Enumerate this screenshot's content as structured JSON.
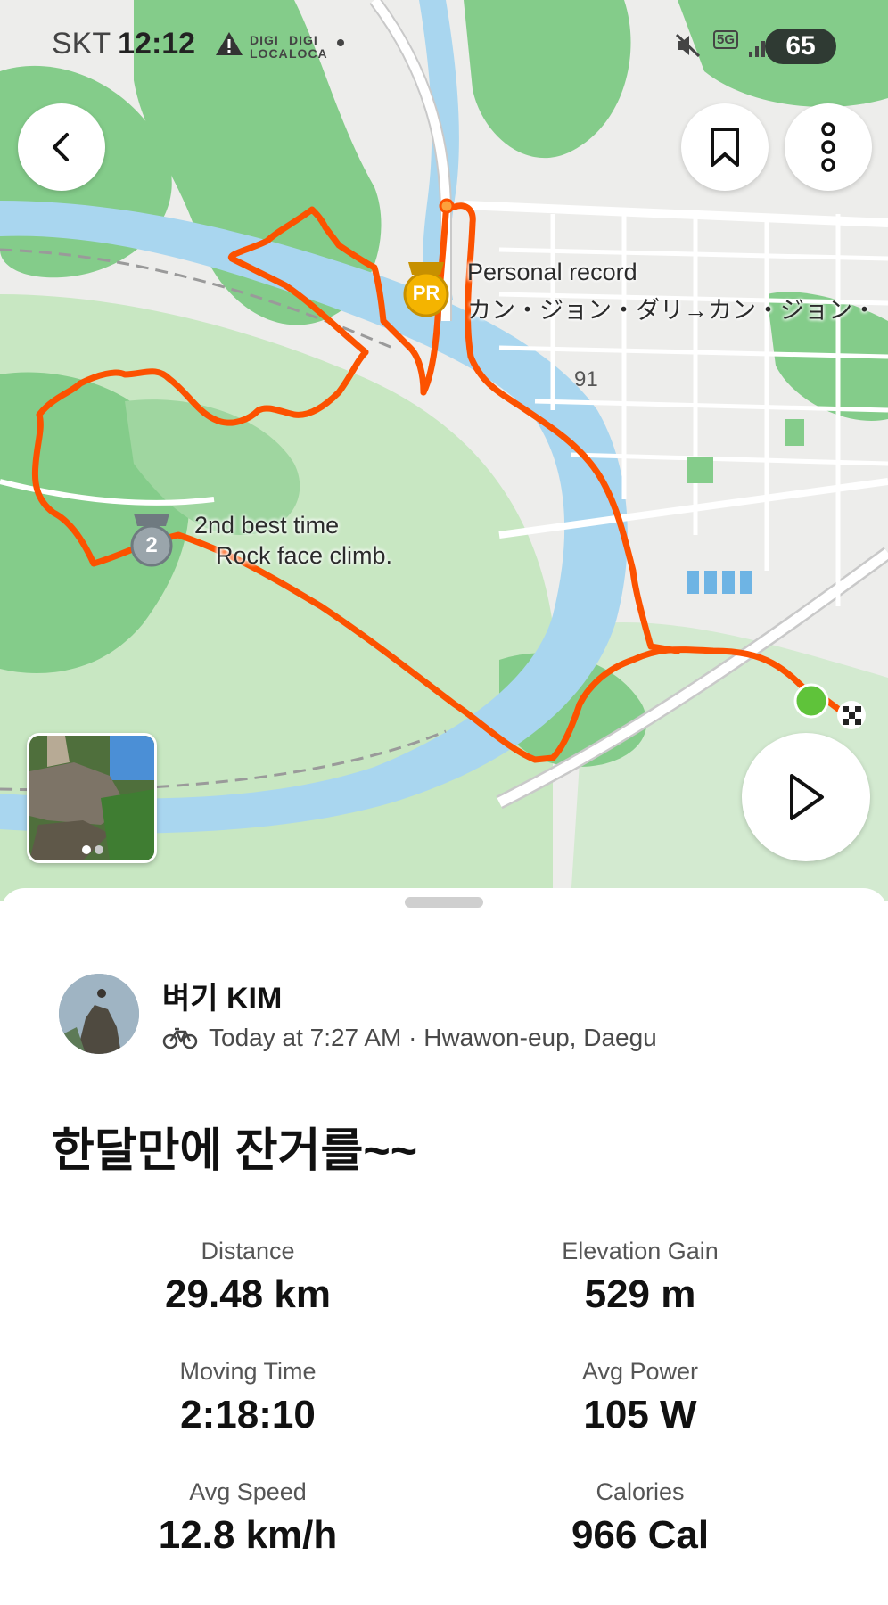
{
  "status_bar": {
    "carrier": "SKT",
    "time": "12:12",
    "digi_a": "DIGI LOCA",
    "digi_b": "DIGI LOCA",
    "network": "5G",
    "battery": "65"
  },
  "map": {
    "pr_label": "Personal record",
    "pr_segment": "カン・ジョン・ダリ→カン・ジョン・",
    "pr_badge": "PR",
    "second_label": "2nd best time",
    "second_segment": "Rock face climb.",
    "second_badge": "2",
    "road_number": "91",
    "colors": {
      "route": "#fc5200",
      "water": "#a9d6ef",
      "park": "#c8e7c2",
      "forest": "#84cc8a",
      "start": "#5fc33a"
    }
  },
  "activity": {
    "athlete_name": "벼기 KIM",
    "sport_icon": "bike-icon",
    "meta": "Today at 7:27 AM · Hwawon-eup, Daegu",
    "title": "한달만에 잔거를~~",
    "stats": [
      {
        "label": "Distance",
        "value": "29.48 km"
      },
      {
        "label": "Elevation Gain",
        "value": "529 m"
      },
      {
        "label": "Moving Time",
        "value": "2:18:10"
      },
      {
        "label": "Avg Power",
        "value": "105 W"
      },
      {
        "label": "Avg Speed",
        "value": "12.8 km/h"
      },
      {
        "label": "Calories",
        "value": "966 Cal"
      }
    ]
  }
}
